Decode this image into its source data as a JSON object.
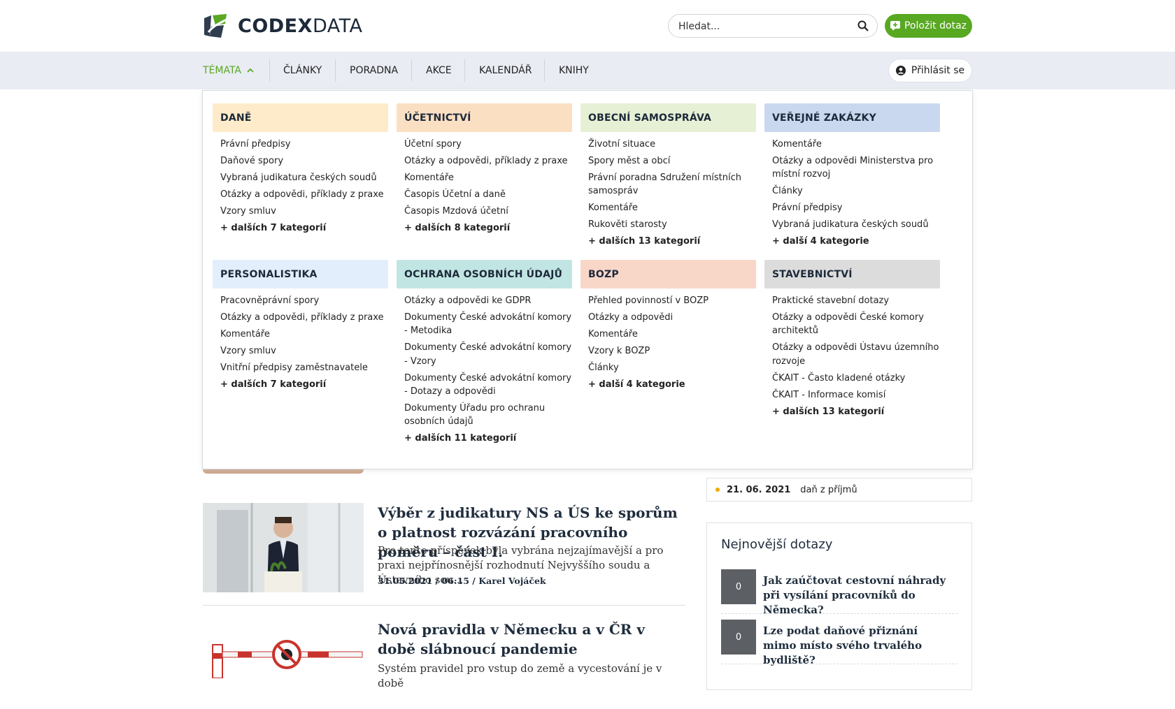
{
  "header": {
    "logo_bold": "CODEX",
    "logo_light": "DATA",
    "search_placeholder": "Hledat...",
    "ask_label": "Položit dotaz"
  },
  "nav": {
    "items": [
      "TÉMATA",
      "ČLÁNKY",
      "PORADNA",
      "AKCE",
      "KALENDÁŘ",
      "KNIHY"
    ],
    "login_label": "Přihlásit se"
  },
  "menu": [
    {
      "title": "DANĚ",
      "color": "#fdebc9",
      "links": [
        "Právní předpisy",
        "Daňové spory",
        "Vybraná judikatura českých soudů",
        "Otázky a odpovědi, příklady z praxe",
        "Vzory smluv"
      ],
      "more": "+ dalších 7 kategorií"
    },
    {
      "title": "ÚČETNICTVÍ",
      "color": "#fbdfc3",
      "links": [
        "Účetní spory",
        "Otázky a odpovědi, příklady z praxe",
        "Komentáře",
        "Časopis Účetní a daně",
        "Časopis Mzdová účetní"
      ],
      "more": "+ dalších 8 kategorií"
    },
    {
      "title": "OBECNÍ SAMOSPRÁVA",
      "color": "#e6f0d5",
      "links": [
        "Životní situace",
        "Spory měst a obcí",
        "Právní poradna Sdružení místních samospráv",
        "Komentáře",
        "Rukověti starosty"
      ],
      "more": "+ dalších 13 kategorií"
    },
    {
      "title": "VEŘEJNÉ ZAKÁZKY",
      "color": "#c9d8ef",
      "links": [
        "Komentáře",
        "Otázky a odpovědi Ministerstva pro místní rozvoj",
        "Články",
        "Právní předpisy",
        "Vybraná judikatura českých soudů"
      ],
      "more": "+ další 4 kategorie"
    },
    {
      "title": "PERSONALISTIKA",
      "color": "#e2eefb",
      "links": [
        "Pracovněprávní spory",
        "Otázky a odpovědi, příklady z praxe",
        "Komentáře",
        "Vzory smluv",
        "Vnitřní předpisy zaměstnavatele"
      ],
      "more": "+ dalších 7 kategorií"
    },
    {
      "title": "OCHRANA OSOBNÍCH ÚDAJŮ",
      "color": "#c1e5e2",
      "links": [
        "Otázky a odpovědi ke GDPR",
        "Dokumenty České advokátní komory - Metodika",
        "Dokumenty České advokátní komory - Vzory",
        "Dokumenty České advokátní komory - Dotazy a odpovědi",
        "Dokumenty Úřadu pro ochranu osobních údajů"
      ],
      "more": "+ dalších 11 kategorií"
    },
    {
      "title": "BOZP",
      "color": "#f8d6c8",
      "links": [
        "Přehled povinností v BOZP",
        "Otázky a odpovědi",
        "Komentáře",
        "Vzory k BOZP",
        "Články"
      ],
      "more": "+ další 4 kategorie"
    },
    {
      "title": "STAVEBNICTVÍ",
      "color": "#dcdcdc",
      "links": [
        "Praktické stavební dotazy",
        "Otázky a odpovědi České komory architektů",
        "Otázky a odpovědi Ústavu územního rozvoje",
        "ČKAIT - Často kladené otázky",
        "ČKAIT - Informace komisí"
      ],
      "more": "+ dalších 13 kategorií"
    }
  ],
  "articles": [
    {
      "title": "Výběr z judikatury NS a ÚS ke sporům o platnost rozvázání pracovního poměru – část I.",
      "perex": "Pro tento příspěvek byla vybrána nejzajímavější a pro praxi nejpřínosnější rozhodnutí Nejvyššího soudu a Ústavního sou...",
      "meta": "31.05.2021  /  06:15  /  Karel Vojáček"
    },
    {
      "title": "Nová pravidla v Německu a v ČR v době slábnoucí pandemie",
      "perex": "Systém pravidel pro vstup do země a vycestování je v době"
    }
  ],
  "deadline": {
    "date": "21. 06. 2021",
    "label": "daň z příjmů"
  },
  "questions": {
    "heading": "Nejnovější dotazy",
    "items": [
      {
        "count": "0",
        "text": "Jak zaúčtovat cestovní náhrady při vysílání pracovníků do Německa?"
      },
      {
        "count": "0",
        "text": "Lze podat daňové přiznání mimo místo svého trvalého bydliště?"
      }
    ]
  }
}
